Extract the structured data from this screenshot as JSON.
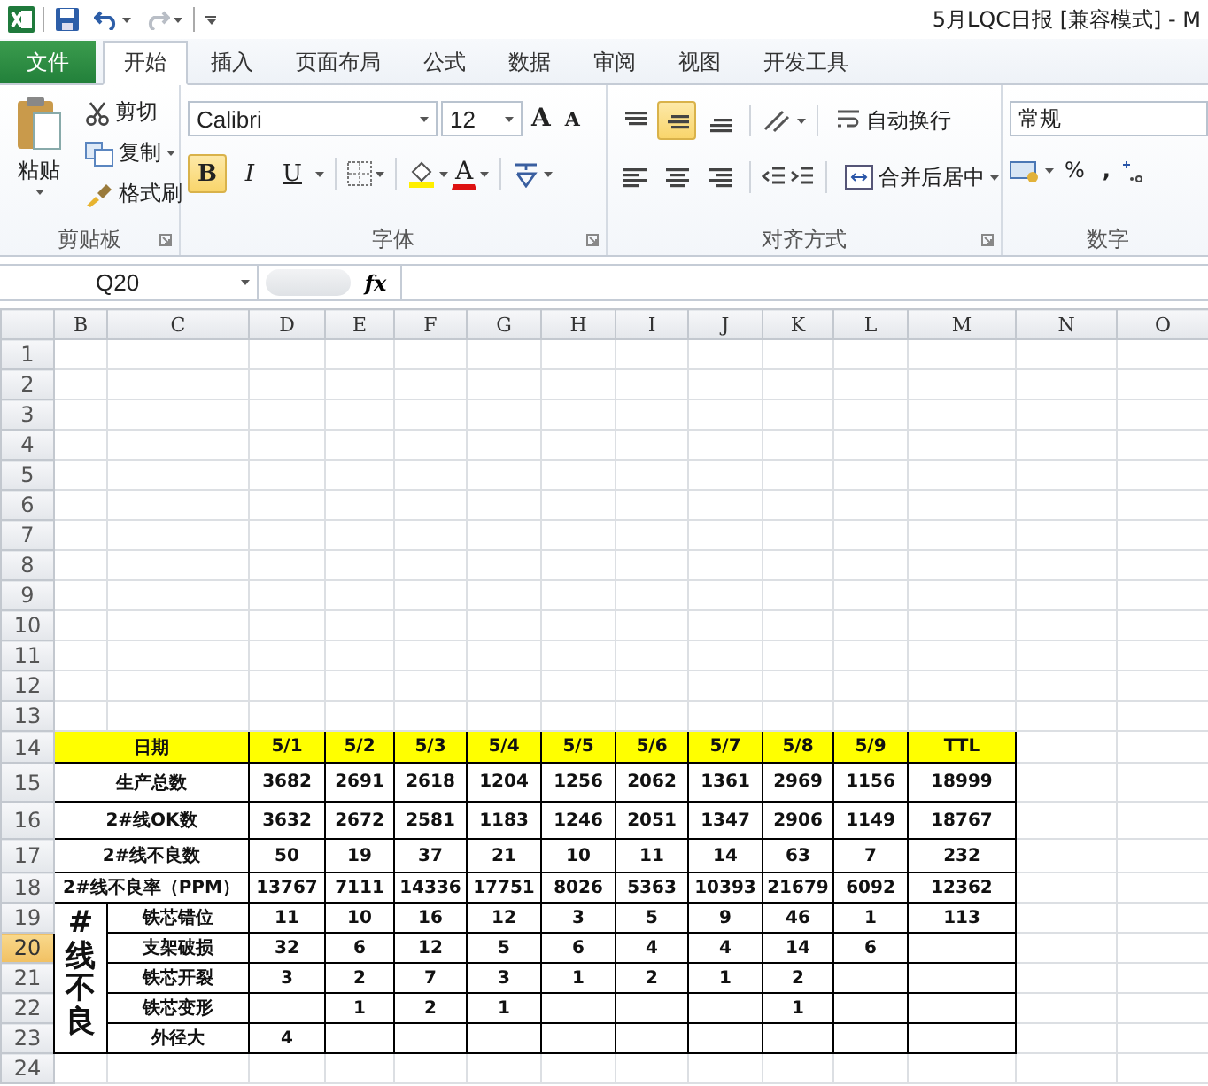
{
  "window": {
    "title": "5月LQC日报  [兼容模式]  -  M"
  },
  "quick_access": [
    {
      "kind": "save",
      "disabled": false
    },
    {
      "kind": "undo",
      "disabled": false
    },
    {
      "kind": "redo",
      "disabled": true
    }
  ],
  "tabs": [
    {
      "label": "文件",
      "kind": "file",
      "selected": false
    },
    {
      "label": "开始",
      "kind": "tab",
      "selected": true
    },
    {
      "label": "插入",
      "kind": "tab",
      "selected": false
    },
    {
      "label": "页面布局",
      "kind": "tab",
      "selected": false
    },
    {
      "label": "公式",
      "kind": "tab",
      "selected": false
    },
    {
      "label": "数据",
      "kind": "tab",
      "selected": false
    },
    {
      "label": "审阅",
      "kind": "tab",
      "selected": false
    },
    {
      "label": "视图",
      "kind": "tab",
      "selected": false
    },
    {
      "label": "开发工具",
      "kind": "tab",
      "selected": false
    }
  ],
  "ribbon": {
    "clipboard": {
      "label": "剪贴板",
      "paste": "粘贴",
      "items": [
        {
          "label": "剪切",
          "kind": "cut"
        },
        {
          "label": "复制",
          "kind": "copy"
        },
        {
          "label": "格式刷",
          "kind": "painter"
        }
      ]
    },
    "font": {
      "label": "字体",
      "font_name": "Calibri",
      "font_size": "12",
      "grow_font": "A",
      "shrink_font": "A",
      "font_color": "A",
      "toggles": [
        {
          "label": "B",
          "kind": "bold",
          "on": true
        },
        {
          "label": "I",
          "kind": "italic",
          "on": false
        },
        {
          "label": "U",
          "kind": "underline",
          "on": false
        }
      ]
    },
    "alignment": {
      "label": "对齐方式",
      "wrap_text": "自动换行",
      "merge": "合并后居中",
      "vertical": [
        {
          "kind": "top",
          "selected": false
        },
        {
          "kind": "middle",
          "selected": true
        },
        {
          "kind": "bottom",
          "selected": false
        }
      ],
      "horizontal": [
        {
          "kind": "left",
          "selected": false
        },
        {
          "kind": "center",
          "selected": false
        },
        {
          "kind": "right",
          "selected": false
        }
      ]
    },
    "number": {
      "label": "数字",
      "format": "常规",
      "percent": "%",
      "comma": ","
    }
  },
  "formula_bar": {
    "name_box": "Q20",
    "fx": "fx"
  },
  "sheet": {
    "columns": [
      "B",
      "C",
      "D",
      "E",
      "F",
      "G",
      "H",
      "I",
      "J",
      "K",
      "L",
      "M",
      "N",
      "O"
    ],
    "rows": [
      {
        "label": "1",
        "selected": false
      },
      {
        "label": "2",
        "selected": false
      },
      {
        "label": "3",
        "selected": false
      },
      {
        "label": "4",
        "selected": false
      },
      {
        "label": "5",
        "selected": false
      },
      {
        "label": "6",
        "selected": false
      },
      {
        "label": "7",
        "selected": false
      },
      {
        "label": "8",
        "selected": false
      },
      {
        "label": "9",
        "selected": false
      },
      {
        "label": "10",
        "selected": false
      },
      {
        "label": "11",
        "selected": false
      },
      {
        "label": "12",
        "selected": false
      },
      {
        "label": "13",
        "selected": false
      },
      {
        "label": "14",
        "selected": false
      },
      {
        "label": "15",
        "selected": false
      },
      {
        "label": "16",
        "selected": false
      },
      {
        "label": "17",
        "selected": false
      },
      {
        "label": "18",
        "selected": false
      },
      {
        "label": "19",
        "selected": false
      },
      {
        "label": "20",
        "selected": true
      },
      {
        "label": "21",
        "selected": false
      },
      {
        "label": "22",
        "selected": false
      },
      {
        "label": "23",
        "selected": false
      },
      {
        "label": "24",
        "selected": false
      }
    ],
    "table": {
      "header": {
        "label": "日期",
        "cells": [
          "5/1",
          "5/2",
          "5/3",
          "5/4",
          "5/5",
          "5/6",
          "5/7",
          "5/8",
          "5/9",
          "TTL"
        ]
      },
      "summary_rows": [
        {
          "label": "生产总数",
          "values": [
            "3682",
            "2691",
            "2618",
            "1204",
            "1256",
            "2062",
            "1361",
            "2969",
            "1156",
            "18999"
          ]
        },
        {
          "label": "2#线OK数",
          "values": [
            "3632",
            "2672",
            "2581",
            "1183",
            "1246",
            "2051",
            "1347",
            "2906",
            "1149",
            "18767"
          ]
        },
        {
          "label": "2#线不良数",
          "values": [
            "50",
            "19",
            "37",
            "21",
            "10",
            "11",
            "14",
            "63",
            "7",
            "232"
          ]
        },
        {
          "label": "2#线不良率（PPM）",
          "values": [
            "13767",
            "7111",
            "14336",
            "17751",
            "8026",
            "5363",
            "10393",
            "21679",
            "6092",
            "12362"
          ]
        }
      ],
      "defect_group": {
        "label": "#线不良",
        "rows": [
          {
            "label": "铁芯错位",
            "values": [
              "11",
              "10",
              "16",
              "12",
              "3",
              "5",
              "9",
              "46",
              "1",
              "113"
            ]
          },
          {
            "label": "支架破损",
            "values": [
              "32",
              "6",
              "12",
              "5",
              "6",
              "4",
              "4",
              "14",
              "6",
              {
                "blank": true
              }
            ]
          },
          {
            "label": "铁芯开裂",
            "values": [
              "3",
              "2",
              "7",
              "3",
              "1",
              "2",
              "1",
              "2",
              {
                "blank": true
              },
              {
                "blank": true
              }
            ]
          },
          {
            "label": "铁芯变形",
            "values": [
              {
                "blank": true
              },
              "1",
              "2",
              "1",
              {
                "blank": true
              },
              {
                "blank": true
              },
              {
                "blank": true
              },
              "1",
              {
                "blank": true
              },
              {
                "blank": true
              }
            ]
          },
          {
            "label": "外径大",
            "values": [
              "4",
              {
                "blank": true
              },
              {
                "blank": true
              },
              {
                "blank": true
              },
              {
                "blank": true
              },
              {
                "blank": true
              },
              {
                "blank": true
              },
              {
                "blank": true
              },
              {
                "blank": true
              },
              {
                "blank": true
              }
            ]
          }
        ]
      }
    }
  }
}
